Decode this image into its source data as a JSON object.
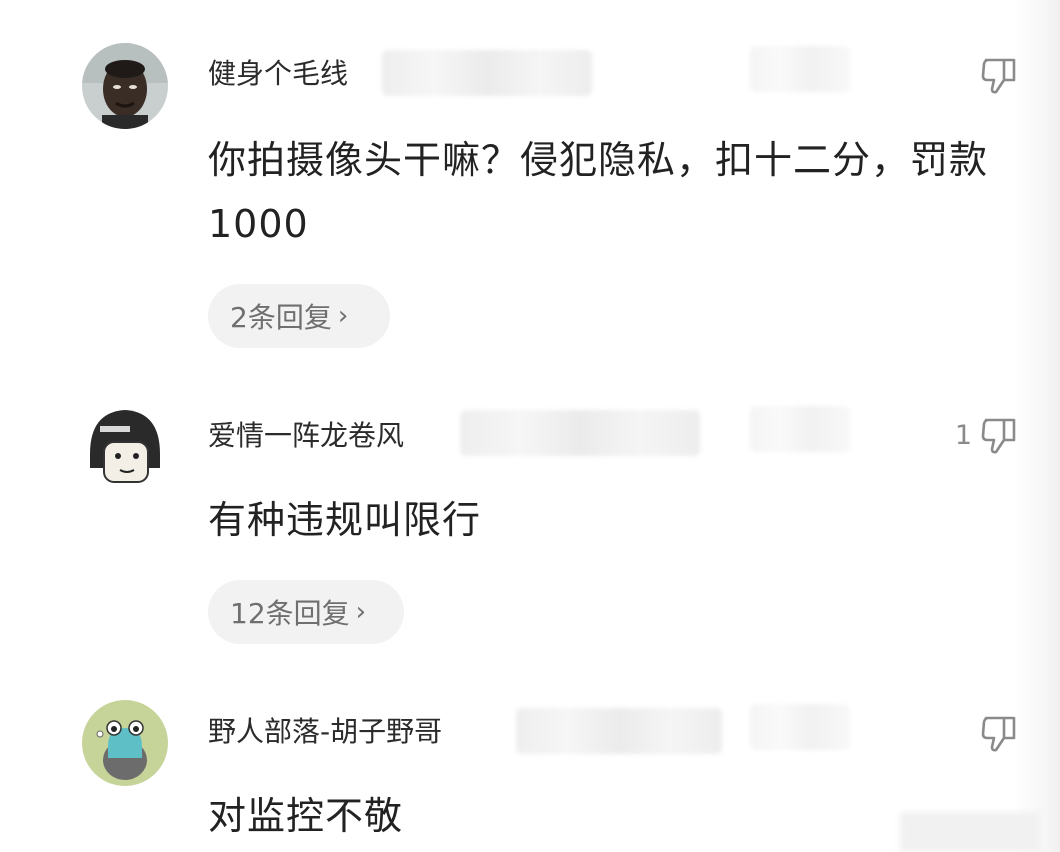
{
  "comments": [
    {
      "username": "健身个毛线",
      "content": "你拍摄像头干嘛？侵犯隐私，扣十二分，罚款1000",
      "replies": "2条回复",
      "likes": "",
      "avatar": "avatar-photo-man"
    },
    {
      "username": "爱情一阵龙卷风",
      "content": "有种违规叫限行",
      "replies": "12条回复",
      "likes": "1",
      "avatar": "avatar-helmet-meme"
    },
    {
      "username": "野人部落-胡子野哥",
      "content": "对监控不敬",
      "replies": "",
      "likes": "",
      "avatar": "avatar-frog-cartoon"
    }
  ],
  "icons": {
    "like": "thumbs-down-icon",
    "chevron": "chevron-right-icon"
  },
  "chevron_glyph": "›",
  "colors": {
    "text_primary": "#222222",
    "text_secondary": "#6f6f6f",
    "pill_bg": "#f2f2f2",
    "icon_stroke": "#8a8a8a"
  }
}
